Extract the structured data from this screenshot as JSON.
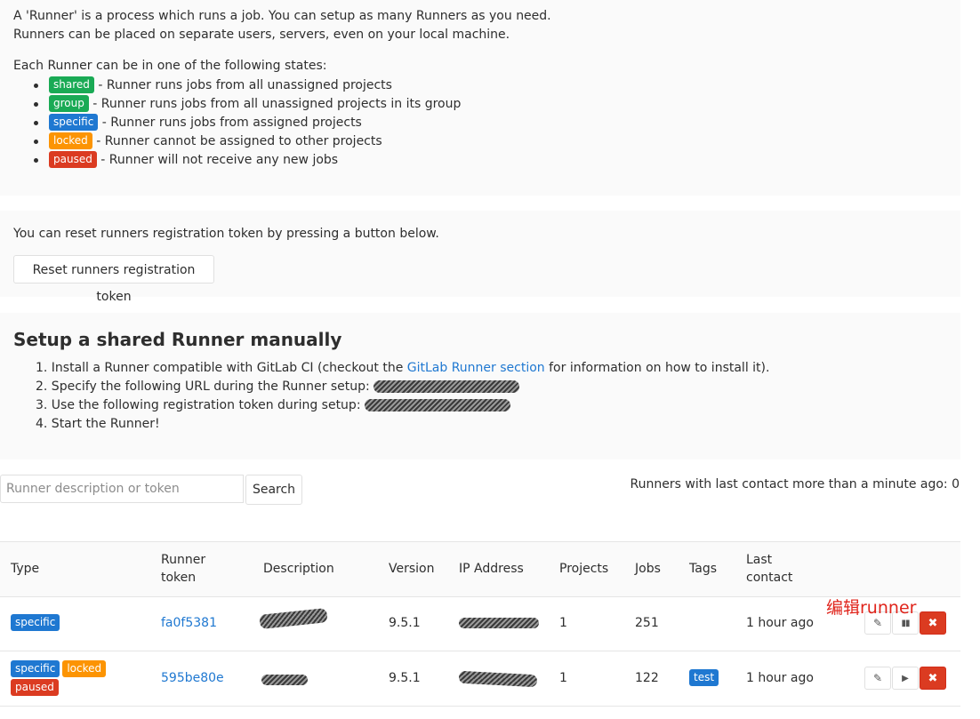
{
  "intro": {
    "line1": "A 'Runner' is a process which runs a job. You can setup as many Runners as you need.",
    "line2": "Runners can be placed on separate users, servers, even on your local machine.",
    "states_heading": "Each Runner can be in one of the following states:",
    "states": [
      {
        "badge": "shared",
        "text": " - Runner runs jobs from all unassigned projects",
        "color": "#1aaa55"
      },
      {
        "badge": "group",
        "text": " - Runner runs jobs from all unassigned projects in its group",
        "color": "#1aaa55"
      },
      {
        "badge": "specific",
        "text": " - Runner runs jobs from assigned projects",
        "color": "#1f78d1"
      },
      {
        "badge": "locked",
        "text": " - Runner cannot be assigned to other projects",
        "color": "#fc9403"
      },
      {
        "badge": "paused",
        "text": " - Runner will not receive any new jobs",
        "color": "#db3b21"
      }
    ]
  },
  "reset": {
    "text": "You can reset runners registration token by pressing a button below.",
    "button": "Reset runners registration token"
  },
  "setup": {
    "title": "Setup a shared Runner manually",
    "step1_prefix": "1. Install a Runner compatible with GitLab CI (checkout the ",
    "step1_link": "GitLab Runner section",
    "step1_suffix": " for information on how to install it).",
    "step2": "2. Specify the following URL during the Runner setup: ",
    "step3": "3. Use the following registration token during setup: ",
    "step4": "4. Start the Runner!"
  },
  "search": {
    "placeholder": "Runner description or token",
    "button": "Search",
    "last_contact_text": "Runners with last contact more than a minute ago: 0"
  },
  "table": {
    "headers": {
      "type": "Type",
      "runner_token_1": "Runner",
      "runner_token_2": "token",
      "description": "Description",
      "version": "Version",
      "ip": "IP Address",
      "projects": "Projects",
      "jobs": "Jobs",
      "tags": "Tags",
      "last_contact_1": "Last",
      "last_contact_2": "contact"
    },
    "rows": [
      {
        "badges": [
          "specific"
        ],
        "token": "fa0f5381",
        "version": "9.5.1",
        "projects": "1",
        "jobs": "251",
        "tags": "",
        "last_contact": "1 hour ago",
        "toggle": "pause-icon"
      },
      {
        "badges": [
          "specific",
          "locked",
          "paused"
        ],
        "token": "595be80e",
        "version": "9.5.1",
        "projects": "1",
        "jobs": "122",
        "tags": "test",
        "last_contact": "1 hour ago",
        "toggle": "play-icon"
      }
    ]
  },
  "annotation": "编辑runner"
}
